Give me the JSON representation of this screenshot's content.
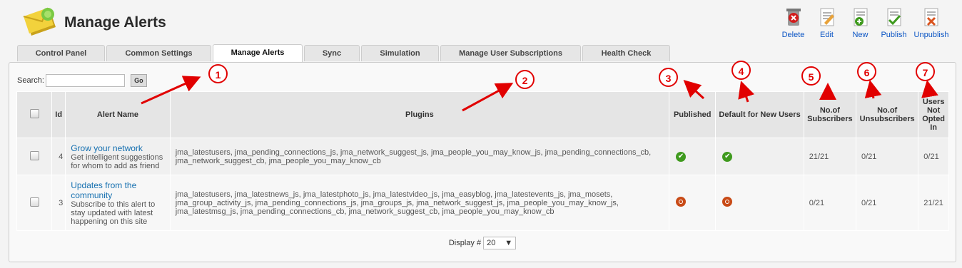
{
  "header": {
    "title": "Manage Alerts"
  },
  "toolbar": [
    {
      "label": "Delete",
      "icon": "delete-icon"
    },
    {
      "label": "Edit",
      "icon": "edit-icon"
    },
    {
      "label": "New",
      "icon": "new-icon"
    },
    {
      "label": "Publish",
      "icon": "publish-icon"
    },
    {
      "label": "Unpublish",
      "icon": "unpublish-icon"
    }
  ],
  "tabs": [
    {
      "label": "Control Panel"
    },
    {
      "label": "Common Settings"
    },
    {
      "label": "Manage Alerts",
      "active": true
    },
    {
      "label": "Sync"
    },
    {
      "label": "Simulation"
    },
    {
      "label": "Manage User Subscriptions"
    },
    {
      "label": "Health Check"
    }
  ],
  "search": {
    "label": "Search:",
    "value": "",
    "go_label": "Go"
  },
  "table": {
    "columns": {
      "id": "Id",
      "alert_name": "Alert Name",
      "plugins": "Plugins",
      "published": "Published",
      "default_new_users": "Default for New Users",
      "subscribers": "No.of Subscribers",
      "unsubscribers": "No.of Unsubscribers",
      "not_opted_in": "Users Not Opted In"
    },
    "rows": [
      {
        "id": "4",
        "name": "Grow your network",
        "description": "Get intelligent suggestions for whom to add as friend",
        "plugins": "jma_latestusers, jma_pending_connections_js, jma_network_suggest_js, jma_people_you_may_know_js, jma_pending_connections_cb, jma_network_suggest_cb, jma_people_you_may_know_cb",
        "published": true,
        "default_new_users": true,
        "subscribers": "21/21",
        "unsubscribers": "0/21",
        "not_opted_in": "0/21"
      },
      {
        "id": "3",
        "name": "Updates from the community",
        "description": "Subscribe to this alert to stay updated with latest happening on this site",
        "plugins": "jma_latestusers, jma_latestnews_js, jma_latestphoto_js, jma_latestvideo_js, jma_easyblog, jma_latestevents_js, jma_mosets, jma_group_activity_js, jma_pending_connections_js, jma_groups_js, jma_network_suggest_js, jma_people_you_may_know_js, jma_latestmsg_js, jma_pending_connections_cb, jma_network_suggest_cb, jma_people_you_may_know_cb",
        "published": false,
        "default_new_users": false,
        "subscribers": "0/21",
        "unsubscribers": "0/21",
        "not_opted_in": "21/21"
      }
    ]
  },
  "footer": {
    "display_label": "Display #",
    "display_value": "20"
  },
  "markers": [
    "1",
    "2",
    "3",
    "4",
    "5",
    "6",
    "7"
  ],
  "colors": {
    "marker": "#e10000",
    "link": "#1670b0",
    "toolbar_link": "#0b55c4"
  }
}
